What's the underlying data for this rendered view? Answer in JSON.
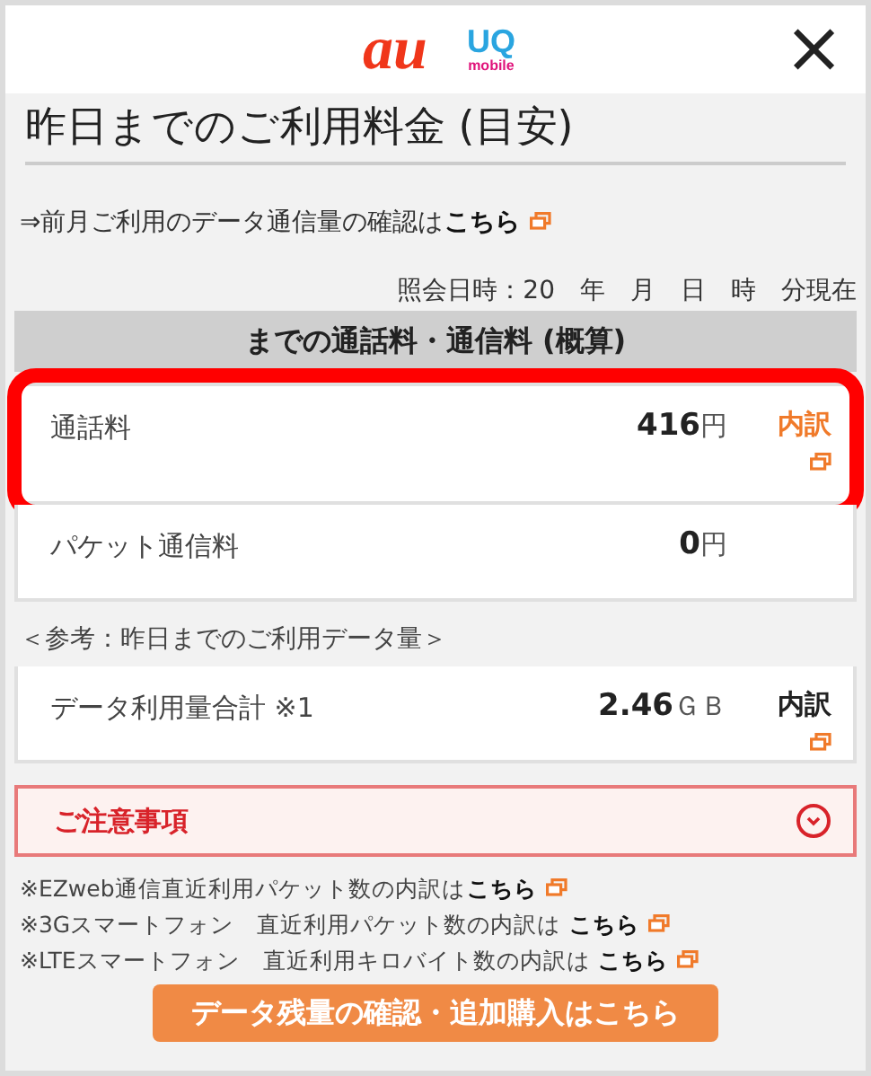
{
  "header": {
    "logo_primary": "au",
    "logo_secondary": "UQ",
    "logo_secondary_sub": "mobile",
    "close": "×"
  },
  "title": "昨日までのご利用料金 (目安)",
  "prev_month": {
    "text": "⇒前月ご利用のデータ通信量の確認は",
    "link": "こちら"
  },
  "timestamp": "照会日時：20　年　月　日　時　分現在",
  "charges": {
    "heading": "までの通話料・通信料 (概算)",
    "rows": [
      {
        "label": "通話料",
        "amount": "416",
        "unit": "円",
        "breakdown": "内訳",
        "accent": true,
        "highlighted": true
      },
      {
        "label": "パケット通信料",
        "amount": "0",
        "unit": "円",
        "highlighted": false
      }
    ]
  },
  "reference": {
    "heading": "＜参考：昨日までのご利用データ量＞",
    "rows": [
      {
        "label": "データ利用量合計 ※1",
        "amount": "2.46",
        "unit": "ＧＢ",
        "breakdown": "内訳",
        "accent": false,
        "highlighted": false
      }
    ]
  },
  "caution": {
    "label": "ご注意事項",
    "expanded": false
  },
  "notes": [
    {
      "text": "※EZweb通信直近利用パケット数の内訳は",
      "link": "こちら"
    },
    {
      "text": "※3Gスマートフォン　直近利用パケット数の内訳は ",
      "link": "こちら"
    },
    {
      "text": "※LTEスマートフォン　直近利用キロバイト数の内訳は ",
      "link": "こちら"
    }
  ],
  "button": "データ残量の確認・追加購入はこちら"
}
